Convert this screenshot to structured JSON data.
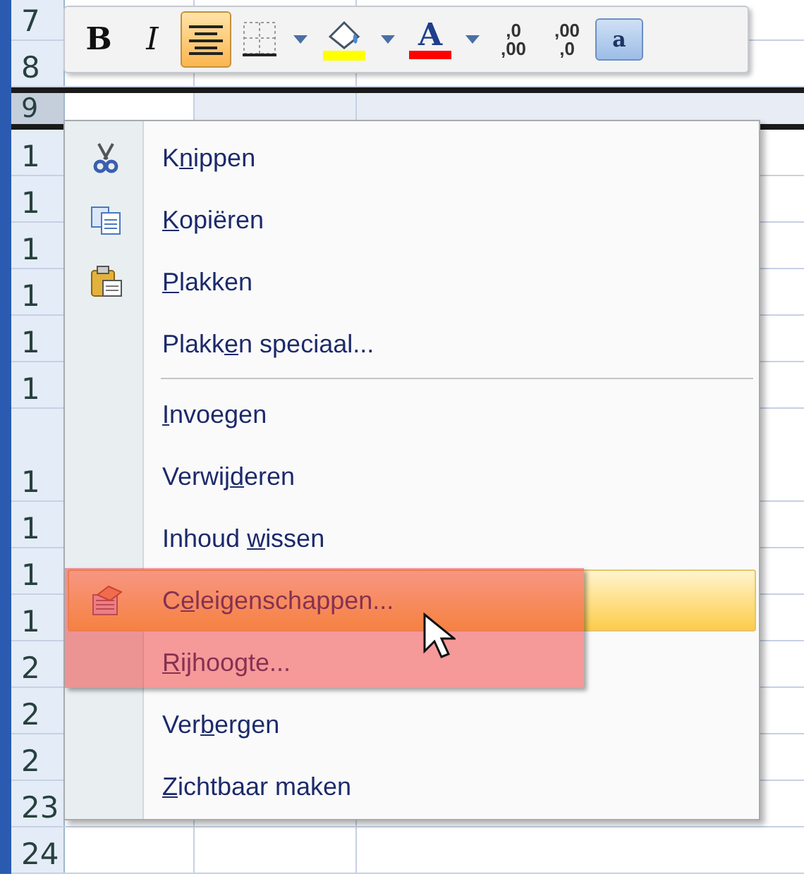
{
  "toolbar": {
    "buttons": [
      {
        "kind": "bold",
        "label": "B",
        "selected": false
      },
      {
        "kind": "italic",
        "label": "I",
        "selected": false
      },
      {
        "kind": "align-center",
        "selected": true
      },
      {
        "kind": "borders",
        "selected": false
      },
      {
        "kind": "dropdown",
        "selected": false
      },
      {
        "kind": "fill-color",
        "color": "#ffff00",
        "selected": false
      },
      {
        "kind": "dropdown",
        "selected": false
      },
      {
        "kind": "font-color",
        "label": "A",
        "color": "#ff0000",
        "selected": false
      },
      {
        "kind": "dropdown",
        "selected": false
      },
      {
        "kind": "decimal-increase",
        "top": ",0",
        "bottom": ",00",
        "selected": false
      },
      {
        "kind": "decimal-decrease",
        "top": ",00",
        "bottom": ",0",
        "selected": false
      },
      {
        "kind": "merge",
        "label": "a",
        "selected": false
      }
    ]
  },
  "sheet": {
    "rows": [
      {
        "number": "7",
        "selected": false,
        "tall": false
      },
      {
        "number": "8",
        "selected": false,
        "tall": false
      },
      {
        "number": "9",
        "selected": true,
        "tall": false
      },
      {
        "number": "1",
        "selected": false,
        "tall": false
      },
      {
        "number": "1",
        "selected": false,
        "tall": false
      },
      {
        "number": "1",
        "selected": false,
        "tall": false
      },
      {
        "number": "1",
        "selected": false,
        "tall": false
      },
      {
        "number": "1",
        "selected": false,
        "tall": false
      },
      {
        "number": "1",
        "selected": false,
        "tall": false
      },
      {
        "number": "1",
        "selected": false,
        "tall": true
      },
      {
        "number": "1",
        "selected": false,
        "tall": false
      },
      {
        "number": "1",
        "selected": false,
        "tall": false
      },
      {
        "number": "1",
        "selected": false,
        "tall": false
      },
      {
        "number": "2",
        "selected": false,
        "tall": false
      },
      {
        "number": "2",
        "selected": false,
        "tall": false
      },
      {
        "number": "2",
        "selected": false,
        "tall": false
      },
      {
        "number": "23",
        "selected": false,
        "tall": false
      },
      {
        "number": "24",
        "selected": false,
        "tall": false
      }
    ]
  },
  "context_menu": {
    "groups": [
      {
        "items": [
          {
            "kind": "cut",
            "label_before": "K",
            "accel": "n",
            "label_after": "ippen",
            "selected": false
          },
          {
            "kind": "copy",
            "accel": "K",
            "label_after": "opiëren",
            "selected": false
          },
          {
            "kind": "paste",
            "accel": "P",
            "label_after": "lakken",
            "selected": false
          },
          {
            "kind": "plain",
            "label_before": "Plakk",
            "accel": "e",
            "label_after": "n speciaal...",
            "selected": false
          }
        ]
      },
      {
        "items": [
          {
            "kind": "plain",
            "accel": "I",
            "label_after": "nvoegen",
            "selected": false
          },
          {
            "kind": "plain",
            "label_before": "Verwij",
            "accel": "d",
            "label_after": "eren",
            "selected": false
          },
          {
            "kind": "plain",
            "label_before": "Inhoud ",
            "accel": "w",
            "label_after": "issen",
            "selected": false
          },
          {
            "kind": "format-cells",
            "label_before": "C",
            "accel": "e",
            "label_after": "leigenschappen...",
            "selected": true
          },
          {
            "kind": "plain",
            "accel": "R",
            "label_after": "ijhoogte...",
            "selected": false
          },
          {
            "kind": "plain",
            "label_before": "Ver",
            "accel": "b",
            "label_after": "ergen",
            "selected": false
          },
          {
            "kind": "plain",
            "accel": "Z",
            "label_after": "ichtbaar maken",
            "selected": false
          }
        ]
      }
    ]
  }
}
